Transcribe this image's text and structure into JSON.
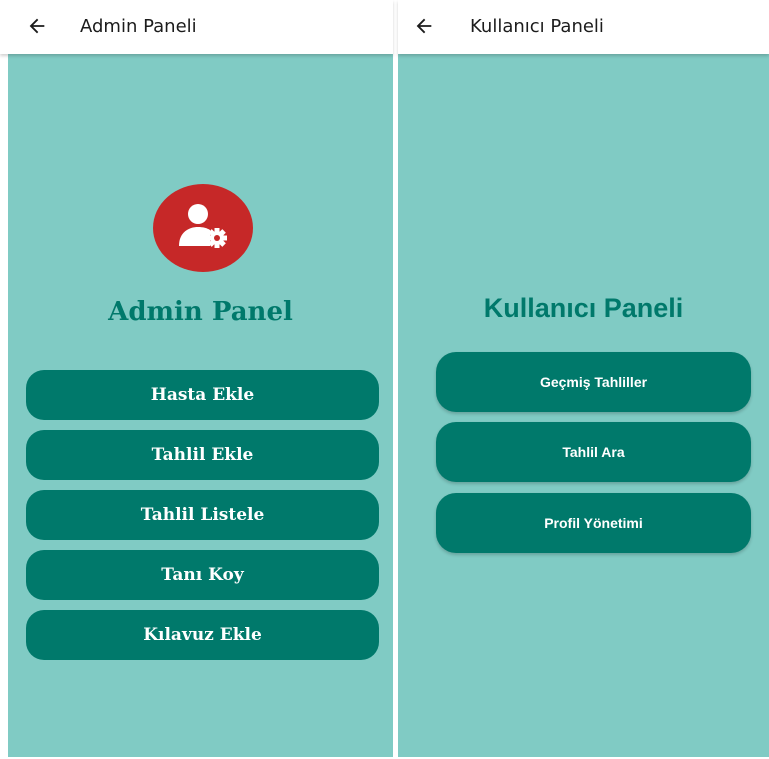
{
  "admin": {
    "title": "Admin Paneli",
    "heading": "Admin Panel",
    "icon": "admin-settings-icon",
    "buttons": [
      {
        "label": "Hasta Ekle"
      },
      {
        "label": "Tahlil Ekle"
      },
      {
        "label": "Tahlil Listele"
      },
      {
        "label": "Tanı Koy"
      },
      {
        "label": "Kılavuz Ekle"
      }
    ]
  },
  "user": {
    "title": "Kullanıcı Paneli",
    "heading": "Kullanıcı Paneli",
    "buttons": [
      {
        "label": "Geçmiş Tahliller"
      },
      {
        "label": "Tahlil Ara"
      },
      {
        "label": "Profil Yönetimi"
      }
    ]
  },
  "colors": {
    "background": "#80cbc4",
    "primary": "#00796b",
    "accent_red": "#c62828",
    "appbar": "#ffffff"
  }
}
